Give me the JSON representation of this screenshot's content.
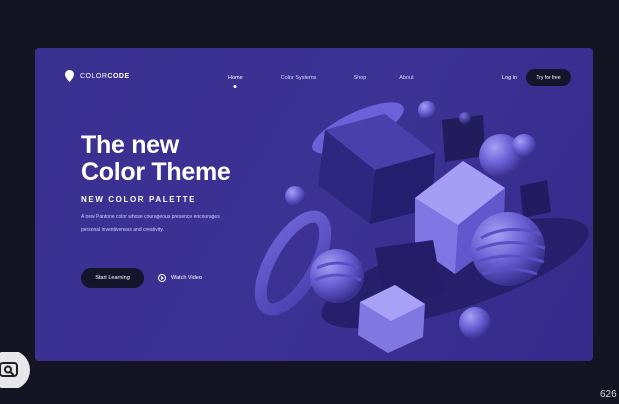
{
  "logo": {
    "prefix": "COLOR",
    "suffix": "CODE",
    "icon": "map-pin-icon"
  },
  "nav": {
    "links": [
      "Home",
      "Color Systems",
      "Shop",
      "About"
    ],
    "active": "Home",
    "login_label": "Log in",
    "cta_label": "Try for free"
  },
  "hero": {
    "title_line1": "The new",
    "title_line2": "Color Theme",
    "subtitle": "NEW COLOR PALETTE",
    "desc_line1": "A new Pantone color whose courageous presence encourages",
    "desc_line2": "personal inventiveness and creativity.",
    "start_label": "Start Learning",
    "watch_label": "Watch Video"
  },
  "corner_text": "626",
  "colors": {
    "page_bg": "#141423",
    "card_bg": "#3b318f",
    "button_dark": "#16142a",
    "accent_light": "#8a80e8"
  }
}
